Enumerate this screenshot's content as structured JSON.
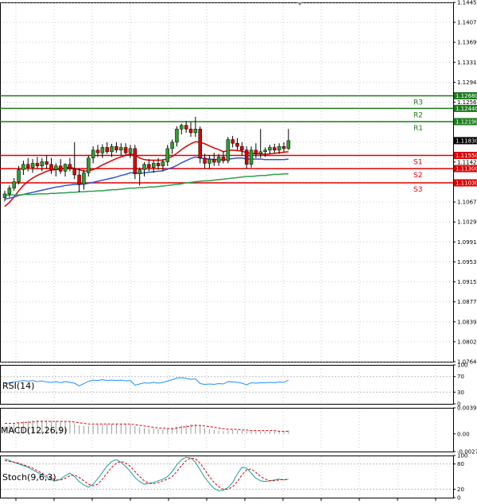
{
  "chart_data": [
    {
      "type": "candlestick",
      "panel": "price",
      "ylim": [
        1.0764,
        1.1445
      ],
      "price_axis_labels": [
        "1.14450",
        "1.14070",
        "1.13690",
        "1.13310",
        "1.12940",
        "1.12560",
        "1.12180",
        "1.11800",
        "1.11420",
        "1.11040",
        "1.10670",
        "1.10290",
        "1.09910",
        "1.09530",
        "1.09150",
        "1.08770",
        "1.08390",
        "1.08020",
        "1.07640"
      ],
      "levels": [
        {
          "name": "R3",
          "value": 1.1268,
          "tag": "1.12680",
          "color": "#1e7a1e"
        },
        {
          "name": "R2",
          "value": 1.1244,
          "tag": "1.12440",
          "color": "#1e7a1e"
        },
        {
          "name": "R1",
          "value": 1.1219,
          "tag": "1.12190",
          "color": "#1e7a1e"
        },
        {
          "name": "S1",
          "value": 1.1155,
          "tag": "1.11550",
          "color": "#dd0000"
        },
        {
          "name": "S2",
          "value": 1.113,
          "tag": "1.11300",
          "color": "#dd0000"
        },
        {
          "name": "S3",
          "value": 1.1103,
          "tag": "1.11030",
          "color": "#dd0000"
        }
      ],
      "current_price": {
        "value": 1.1183,
        "tag": "1.11830"
      },
      "candles": [
        {
          "o": 1.1075,
          "h": 1.1088,
          "l": 1.1068,
          "c": 1.1082
        },
        {
          "o": 1.1082,
          "h": 1.1098,
          "l": 1.1076,
          "c": 1.1093
        },
        {
          "o": 1.1093,
          "h": 1.1112,
          "l": 1.1088,
          "c": 1.1105
        },
        {
          "o": 1.1105,
          "h": 1.1135,
          "l": 1.11,
          "c": 1.1128
        },
        {
          "o": 1.1128,
          "h": 1.1145,
          "l": 1.1118,
          "c": 1.1138
        },
        {
          "o": 1.1138,
          "h": 1.115,
          "l": 1.1125,
          "c": 1.1132
        },
        {
          "o": 1.1132,
          "h": 1.1148,
          "l": 1.1122,
          "c": 1.114
        },
        {
          "o": 1.114,
          "h": 1.1152,
          "l": 1.113,
          "c": 1.1135
        },
        {
          "o": 1.1135,
          "h": 1.115,
          "l": 1.1125,
          "c": 1.1143
        },
        {
          "o": 1.1143,
          "h": 1.1155,
          "l": 1.113,
          "c": 1.1138
        },
        {
          "o": 1.1138,
          "h": 1.115,
          "l": 1.112,
          "c": 1.1128
        },
        {
          "o": 1.1128,
          "h": 1.114,
          "l": 1.1115,
          "c": 1.1135
        },
        {
          "o": 1.1135,
          "h": 1.1148,
          "l": 1.112,
          "c": 1.1125
        },
        {
          "o": 1.1125,
          "h": 1.114,
          "l": 1.1115,
          "c": 1.1138
        },
        {
          "o": 1.1138,
          "h": 1.115,
          "l": 1.1125,
          "c": 1.113
        },
        {
          "o": 1.113,
          "h": 1.118,
          "l": 1.111,
          "c": 1.1118
        },
        {
          "o": 1.1118,
          "h": 1.113,
          "l": 1.1085,
          "c": 1.11
        },
        {
          "o": 1.11,
          "h": 1.1128,
          "l": 1.109,
          "c": 1.1122
        },
        {
          "o": 1.1122,
          "h": 1.1155,
          "l": 1.1115,
          "c": 1.115
        },
        {
          "o": 1.115,
          "h": 1.1172,
          "l": 1.114,
          "c": 1.1165
        },
        {
          "o": 1.1165,
          "h": 1.1175,
          "l": 1.1152,
          "c": 1.116
        },
        {
          "o": 1.116,
          "h": 1.1176,
          "l": 1.115,
          "c": 1.117
        },
        {
          "o": 1.117,
          "h": 1.118,
          "l": 1.1158,
          "c": 1.1162
        },
        {
          "o": 1.1162,
          "h": 1.1177,
          "l": 1.1152,
          "c": 1.1172
        },
        {
          "o": 1.1172,
          "h": 1.118,
          "l": 1.116,
          "c": 1.1165
        },
        {
          "o": 1.1165,
          "h": 1.1178,
          "l": 1.1155,
          "c": 1.117
        },
        {
          "o": 1.117,
          "h": 1.1178,
          "l": 1.1155,
          "c": 1.116
        },
        {
          "o": 1.116,
          "h": 1.1175,
          "l": 1.115,
          "c": 1.1168
        },
        {
          "o": 1.1168,
          "h": 1.1175,
          "l": 1.111,
          "c": 1.112
        },
        {
          "o": 1.112,
          "h": 1.1132,
          "l": 1.1098,
          "c": 1.1128
        },
        {
          "o": 1.1128,
          "h": 1.1142,
          "l": 1.1115,
          "c": 1.1138
        },
        {
          "o": 1.1138,
          "h": 1.1148,
          "l": 1.1125,
          "c": 1.1132
        },
        {
          "o": 1.1132,
          "h": 1.1145,
          "l": 1.1122,
          "c": 1.114
        },
        {
          "o": 1.114,
          "h": 1.115,
          "l": 1.1128,
          "c": 1.1135
        },
        {
          "o": 1.1135,
          "h": 1.1148,
          "l": 1.1125,
          "c": 1.1143
        },
        {
          "o": 1.1143,
          "h": 1.1175,
          "l": 1.1135,
          "c": 1.1168
        },
        {
          "o": 1.1168,
          "h": 1.1185,
          "l": 1.1158,
          "c": 1.118
        },
        {
          "o": 1.118,
          "h": 1.121,
          "l": 1.1172,
          "c": 1.1205
        },
        {
          "o": 1.1205,
          "h": 1.1215,
          "l": 1.1195,
          "c": 1.1212
        },
        {
          "o": 1.1212,
          "h": 1.122,
          "l": 1.1198,
          "c": 1.1205
        },
        {
          "o": 1.1205,
          "h": 1.1218,
          "l": 1.119,
          "c": 1.1198
        },
        {
          "o": 1.1198,
          "h": 1.1228,
          "l": 1.119,
          "c": 1.1205
        },
        {
          "o": 1.1205,
          "h": 1.121,
          "l": 1.114,
          "c": 1.115
        },
        {
          "o": 1.115,
          "h": 1.1158,
          "l": 1.113,
          "c": 1.114
        },
        {
          "o": 1.114,
          "h": 1.1155,
          "l": 1.113,
          "c": 1.1148
        },
        {
          "o": 1.1148,
          "h": 1.116,
          "l": 1.1135,
          "c": 1.1142
        },
        {
          "o": 1.1142,
          "h": 1.1158,
          "l": 1.1135,
          "c": 1.1152
        },
        {
          "o": 1.1152,
          "h": 1.1162,
          "l": 1.114,
          "c": 1.1145
        },
        {
          "o": 1.1145,
          "h": 1.119,
          "l": 1.114,
          "c": 1.1185
        },
        {
          "o": 1.1185,
          "h": 1.1192,
          "l": 1.117,
          "c": 1.1178
        },
        {
          "o": 1.1178,
          "h": 1.1188,
          "l": 1.1165,
          "c": 1.1172
        },
        {
          "o": 1.1172,
          "h": 1.118,
          "l": 1.1155,
          "c": 1.1165
        },
        {
          "o": 1.1165,
          "h": 1.1172,
          "l": 1.113,
          "c": 1.1138
        },
        {
          "o": 1.1138,
          "h": 1.1172,
          "l": 1.1132,
          "c": 1.1165
        },
        {
          "o": 1.1165,
          "h": 1.1178,
          "l": 1.115,
          "c": 1.1158
        },
        {
          "o": 1.1158,
          "h": 1.1205,
          "l": 1.115,
          "c": 1.1162
        },
        {
          "o": 1.1162,
          "h": 1.117,
          "l": 1.1152,
          "c": 1.1165
        },
        {
          "o": 1.1165,
          "h": 1.1175,
          "l": 1.1158,
          "c": 1.117
        },
        {
          "o": 1.117,
          "h": 1.1177,
          "l": 1.116,
          "c": 1.1165
        },
        {
          "o": 1.1165,
          "h": 1.1178,
          "l": 1.1158,
          "c": 1.1172
        },
        {
          "o": 1.1172,
          "h": 1.118,
          "l": 1.1162,
          "c": 1.1168
        },
        {
          "o": 1.1168,
          "h": 1.1205,
          "l": 1.1165,
          "c": 1.1183
        }
      ],
      "moving_averages": [
        {
          "color": "#dd0000",
          "values": [
            1.1058,
            1.1066,
            1.1076,
            1.1088,
            1.1098,
            1.1106,
            1.1112,
            1.1117,
            1.1121,
            1.1125,
            1.1127,
            1.1128,
            1.1129,
            1.1131,
            1.1133,
            1.113,
            1.1128,
            1.1125,
            1.1126,
            1.1128,
            1.1132,
            1.1137,
            1.1141,
            1.1145,
            1.1149,
            1.1152,
            1.1155,
            1.1158,
            1.1156,
            1.115,
            1.1147,
            1.1146,
            1.1146,
            1.1146,
            1.1146,
            1.1149,
            1.1153,
            1.1159,
            1.1166,
            1.1172,
            1.1177,
            1.1181,
            1.118,
            1.1177,
            1.1173,
            1.1169,
            1.1166,
            1.1162,
            1.1164,
            1.1165,
            1.1164,
            1.1163,
            1.116,
            1.1159,
            1.1158,
            1.1158,
            1.1157,
            1.1158,
            1.1159,
            1.116,
            1.1161,
            1.1162
          ]
        },
        {
          "color": "#3355cc",
          "values": [
            1.1072,
            1.1074,
            1.1076,
            1.1079,
            1.1081,
            1.1083,
            1.1085,
            1.1087,
            1.1089,
            1.1091,
            1.1093,
            1.1095,
            1.1096,
            1.1098,
            1.1099,
            1.11,
            1.11,
            1.1101,
            1.1102,
            1.1104,
            1.1106,
            1.1108,
            1.111,
            1.1112,
            1.1114,
            1.1117,
            1.1119,
            1.1122,
            1.1122,
            1.1121,
            1.1122,
            1.1123,
            1.1124,
            1.1125,
            1.1126,
            1.1129,
            1.1132,
            1.1136,
            1.1141,
            1.1145,
            1.1149,
            1.1152,
            1.115,
            1.1149,
            1.1148,
            1.1147,
            1.1147,
            1.1146,
            1.1148,
            1.1149,
            1.115,
            1.115,
            1.1148,
            1.1148,
            1.1148,
            1.1148,
            1.1147,
            1.1147,
            1.1147,
            1.1147,
            1.1147,
            1.1148
          ]
        },
        {
          "color": "#2e9e4e",
          "values": [
            1.108,
            1.108,
            1.108,
            1.108,
            1.1081,
            1.1081,
            1.1081,
            1.1082,
            1.1082,
            1.1082,
            1.1083,
            1.1083,
            1.1084,
            1.1084,
            1.1085,
            1.1085,
            1.1086,
            1.1086,
            1.1087,
            1.1087,
            1.1088,
            1.1088,
            1.1089,
            1.109,
            1.109,
            1.1091,
            1.1092,
            1.1093,
            1.1093,
            1.1094,
            1.1094,
            1.1095,
            1.1095,
            1.1096,
            1.1097,
            1.1098,
            1.1099,
            1.11,
            1.1101,
            1.1103,
            1.1104,
            1.1105,
            1.1106,
            1.1107,
            1.1107,
            1.1108,
            1.1109,
            1.111,
            1.1111,
            1.1112,
            1.1113,
            1.1114,
            1.1115,
            1.1115,
            1.1116,
            1.1117,
            1.1117,
            1.1118,
            1.1119,
            1.1119,
            1.112,
            1.112
          ]
        }
      ]
    },
    {
      "type": "line",
      "panel": "rsi",
      "label": "RSI(14)",
      "ylim": [
        0,
        100
      ],
      "axis_labels": [
        "100",
        "70",
        "30",
        "0"
      ],
      "color": "#1e90ff",
      "values": [
        52,
        54,
        56,
        58,
        60,
        58,
        60,
        57,
        59,
        56,
        55,
        57,
        54,
        57,
        55,
        53,
        46,
        52,
        58,
        61,
        60,
        62,
        60,
        61,
        60,
        61,
        59,
        60,
        48,
        51,
        54,
        53,
        55,
        53,
        55,
        59,
        62,
        66,
        67,
        65,
        63,
        64,
        52,
        50,
        51,
        50,
        52,
        51,
        57,
        56,
        55,
        53,
        49,
        54,
        53,
        54,
        54,
        55,
        54,
        56,
        55,
        61
      ]
    },
    {
      "type": "histogram",
      "panel": "macd",
      "label": "MACD(12,26,9)",
      "ylim": [
        -0.0027,
        0.00398
      ],
      "axis_labels": [
        "0.00398",
        "0.00",
        "-0.0027"
      ],
      "bar_color": "#999999",
      "signal_color": "#dd0000",
      "bars": [
        0.0012,
        0.0013,
        0.0015,
        0.0017,
        0.0019,
        0.002,
        0.0021,
        0.0021,
        0.0021,
        0.0021,
        0.002,
        0.002,
        0.0019,
        0.0019,
        0.0018,
        0.0016,
        0.0013,
        0.0012,
        0.0012,
        0.0013,
        0.0014,
        0.0014,
        0.0015,
        0.0015,
        0.0015,
        0.0015,
        0.0015,
        0.0015,
        0.0012,
        0.001,
        0.0009,
        0.0008,
        0.0008,
        0.0007,
        0.0007,
        0.0008,
        0.0009,
        0.0011,
        0.0013,
        0.0014,
        0.0015,
        0.0015,
        0.0012,
        0.0009,
        0.0007,
        0.0006,
        0.0005,
        0.0004,
        0.0005,
        0.0006,
        0.0006,
        0.0005,
        0.0004,
        0.0004,
        0.0004,
        0.0004,
        0.0004,
        0.0004,
        0.0004,
        0.0004,
        0.0004,
        0.0005
      ],
      "signal": [
        0.0016,
        0.0016,
        0.0016,
        0.0017,
        0.0017,
        0.0018,
        0.0018,
        0.0019,
        0.0019,
        0.0019,
        0.0019,
        0.0019,
        0.0019,
        0.0019,
        0.0019,
        0.0018,
        0.0017,
        0.0016,
        0.0015,
        0.0015,
        0.0015,
        0.0015,
        0.0015,
        0.0015,
        0.0015,
        0.0015,
        0.0015,
        0.0015,
        0.0014,
        0.0013,
        0.0012,
        0.0011,
        0.001,
        0.0009,
        0.0009,
        0.0008,
        0.0008,
        0.0009,
        0.001,
        0.0011,
        0.0012,
        0.0013,
        0.0013,
        0.0012,
        0.0011,
        0.001,
        0.0009,
        0.0008,
        0.0007,
        0.0007,
        0.0007,
        0.0006,
        0.0006,
        0.0005,
        0.0005,
        0.0005,
        0.0005,
        0.0005,
        0.0005,
        0.0004,
        0.0004,
        0.0004
      ]
    },
    {
      "type": "line",
      "panel": "stoch",
      "label": "Stoch(9,6,3)",
      "ylim": [
        0,
        100
      ],
      "axis_labels": [
        "100",
        "80",
        "20",
        "0"
      ],
      "series": [
        {
          "color": "#1aa0a0",
          "values": [
            92,
            88,
            84,
            80,
            76,
            72,
            66,
            60,
            54,
            48,
            42,
            40,
            44,
            52,
            58,
            50,
            38,
            30,
            25,
            32,
            45,
            60,
            75,
            86,
            90,
            84,
            74,
            62,
            48,
            38,
            32,
            34,
            36,
            40,
            44,
            50,
            62,
            78,
            90,
            96,
            94,
            84,
            66,
            48,
            34,
            22,
            16,
            18,
            24,
            36,
            56,
            72,
            70,
            58,
            46,
            40,
            38,
            40,
            42,
            44,
            42,
            44
          ]
        },
        {
          "color": "#dd0000",
          "dashed": true,
          "values": [
            88,
            86,
            84,
            82,
            78,
            74,
            70,
            64,
            58,
            52,
            46,
            42,
            42,
            46,
            52,
            54,
            48,
            40,
            32,
            28,
            32,
            44,
            58,
            72,
            82,
            86,
            82,
            74,
            62,
            50,
            40,
            34,
            33,
            36,
            40,
            44,
            50,
            62,
            76,
            88,
            94,
            92,
            82,
            66,
            50,
            36,
            26,
            20,
            20,
            26,
            38,
            54,
            66,
            68,
            60,
            50,
            44,
            40,
            40,
            42,
            43,
            43
          ]
        }
      ]
    }
  ]
}
